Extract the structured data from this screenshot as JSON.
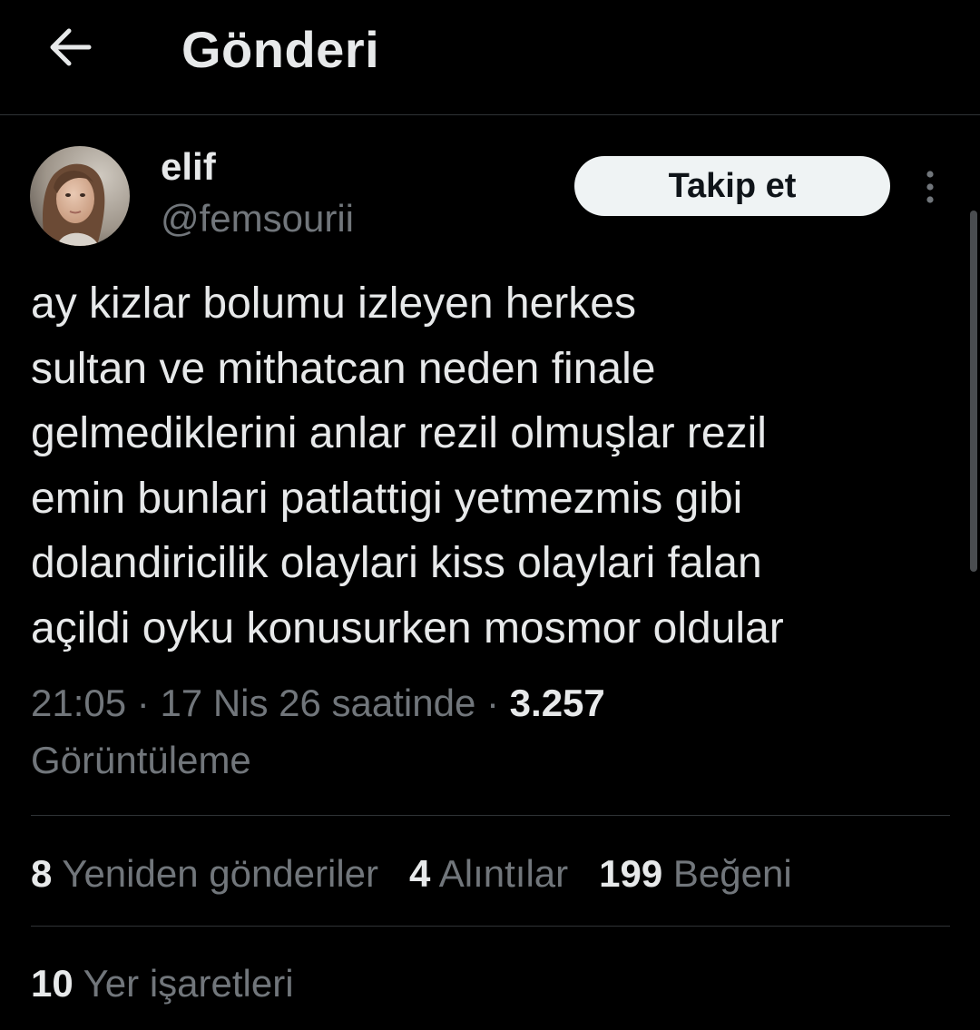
{
  "header": {
    "title": "Gönderi",
    "back_icon": "arrow-left-icon"
  },
  "author": {
    "display_name": "elif",
    "handle": "@femsourii",
    "avatar": "profile-photo"
  },
  "follow_button": {
    "label": "Takip et"
  },
  "more_icon": "vertical-ellipsis-icon",
  "tweet": {
    "lines": [
      "ay kizlar bolumu izleyen herkes",
      "sultan ve mithatcan neden finale",
      "gelmediklerini anlar rezil olmuşlar rezil",
      "emin bunlari patlattigi yetmezmis gibi",
      "dolandiricilik olaylari kiss olaylari falan",
      "açildi oyku konusurken mosmor oldular"
    ]
  },
  "meta": {
    "time": "21:05",
    "separator": " · ",
    "date": "17 Nis 26 saatinde",
    "views_count": "3.257",
    "views_label": "Görüntüleme"
  },
  "stats": {
    "reposts": {
      "count": "8",
      "label": "Yeniden gönderiler"
    },
    "quotes": {
      "count": "4",
      "label": "Alıntılar"
    },
    "likes": {
      "count": "199",
      "label": "Beğeni"
    },
    "bookmarks": {
      "count": "10",
      "label": "Yer işaretleri"
    }
  },
  "colors": {
    "background": "#000000",
    "primary_text": "#e7e9ea",
    "secondary_text": "#71767b",
    "divider": "#2f3336",
    "follow_button_bg": "#eff3f4",
    "follow_button_text": "#0f1419"
  }
}
